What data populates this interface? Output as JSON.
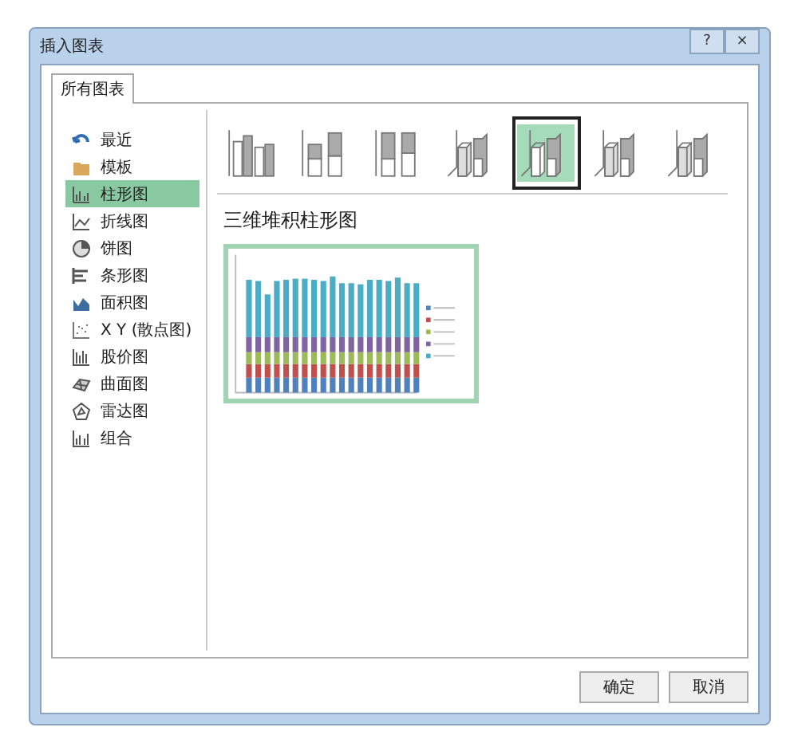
{
  "window": {
    "title": "插入图表",
    "buttons": [
      "?",
      "×"
    ]
  },
  "tabs": [
    {
      "label": "所有图表",
      "selected": true
    }
  ],
  "categories": [
    {
      "label": "最近",
      "kind": "recent",
      "selected": false
    },
    {
      "label": "模板",
      "kind": "template",
      "selected": false
    },
    {
      "label": "柱形图",
      "kind": "column",
      "selected": true
    },
    {
      "label": "折线图",
      "kind": "line",
      "selected": false
    },
    {
      "label": "饼图",
      "kind": "pie",
      "selected": false
    },
    {
      "label": "条形图",
      "kind": "bar",
      "selected": false
    },
    {
      "label": "面积图",
      "kind": "area",
      "selected": false
    },
    {
      "label": "X Y (散点图)",
      "kind": "scatter",
      "selected": false
    },
    {
      "label": "股价图",
      "kind": "stock",
      "selected": false
    },
    {
      "label": "曲面图",
      "kind": "surface",
      "selected": false
    },
    {
      "label": "雷达图",
      "kind": "radar",
      "selected": false
    },
    {
      "label": "组合",
      "kind": "combo",
      "selected": false
    }
  ],
  "subtypes": [
    {
      "kind": "clustered",
      "selected": false
    },
    {
      "kind": "stacked",
      "selected": false
    },
    {
      "kind": "percent",
      "selected": false
    },
    {
      "kind": "clustered3d",
      "selected": false
    },
    {
      "kind": "stacked3d",
      "selected": true
    },
    {
      "kind": "percent3d",
      "selected": false
    },
    {
      "kind": "column3d",
      "selected": false
    }
  ],
  "subtype_name": "三维堆积柱形图",
  "buttons": [
    "确定",
    "取消"
  ]
}
